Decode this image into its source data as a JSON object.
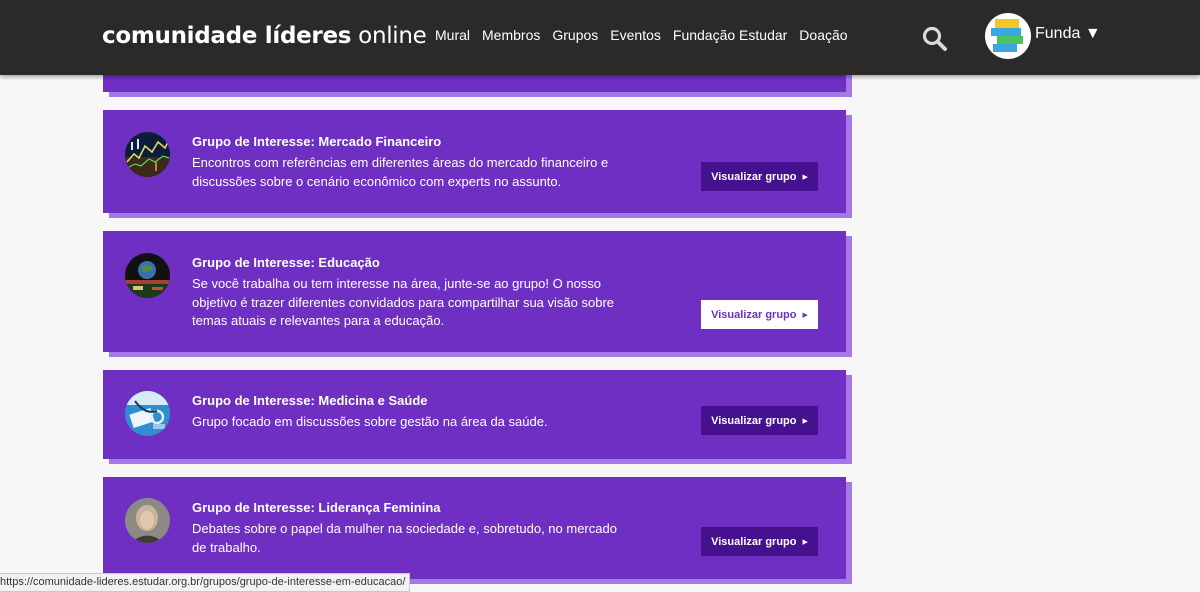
{
  "header": {
    "brand_bold": "comunidade líderes",
    "brand_light": "online",
    "nav": [
      "Mural",
      "Membros",
      "Grupos",
      "Eventos",
      "Fundação Estudar",
      "Doação"
    ],
    "user_name": "Funda ▼"
  },
  "groups": [
    {
      "title": "Grupo de Interesse: Mercado Financeiro",
      "description": "Encontros com referências em diferentes áreas do mercado financeiro e discussões sobre o cenário econômico com experts no assunto.",
      "button": "Visualizar grupo"
    },
    {
      "title": "Grupo de Interesse: Educação",
      "description": "Se você trabalha ou tem interesse na área, junte-se ao grupo! O nosso objetivo é trazer diferentes convidados para compartilhar sua visão sobre temas atuais e relevantes para a educação.",
      "button": "Visualizar grupo"
    },
    {
      "title": "Grupo de Interesse: Medicina e Saúde",
      "description": "Grupo focado em discussões sobre gestão na área da saúde.",
      "button": "Visualizar grupo"
    },
    {
      "title": "Grupo de Interesse: Liderança Feminina",
      "description": "Debates sobre o papel da mulher na sociedade e, sobretudo, no mercado de trabalho.",
      "button": "Visualizar grupo"
    }
  ],
  "status_url": "https://comunidade-lideres.estudar.org.br/grupos/grupo-de-interesse-em-educacao/",
  "colors": {
    "header_bg": "#2b2a29",
    "card_bg": "#6f2fc2",
    "card_shadow": "#a578e8",
    "button_bg": "#45118f"
  }
}
